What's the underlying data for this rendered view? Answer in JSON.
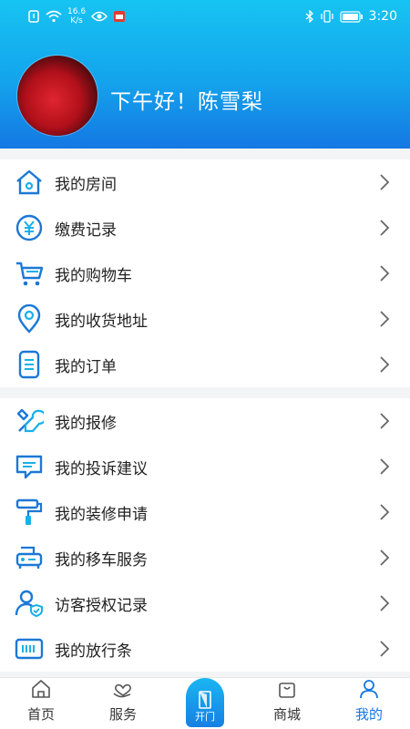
{
  "status": {
    "speed": "16.6",
    "speed_unit": "K/s",
    "time": "3:20"
  },
  "profile": {
    "greeting": "下午好！陈雪梨"
  },
  "menu_group1": [
    {
      "label": "我的房间",
      "icon": "house-icon"
    },
    {
      "label": "缴费记录",
      "icon": "yen-coin-icon"
    },
    {
      "label": "我的购物车",
      "icon": "cart-icon"
    },
    {
      "label": "我的收货地址",
      "icon": "location-pin-icon"
    },
    {
      "label": "我的订单",
      "icon": "order-doc-icon"
    }
  ],
  "menu_group2": [
    {
      "label": "我的报修",
      "icon": "repair-tools-icon"
    },
    {
      "label": "我的投诉建议",
      "icon": "complaint-message-icon"
    },
    {
      "label": "我的装修申请",
      "icon": "paint-roller-icon"
    },
    {
      "label": "我的移车服务",
      "icon": "car-move-icon"
    },
    {
      "label": "访客授权记录",
      "icon": "visitor-shield-icon"
    },
    {
      "label": "我的放行条",
      "icon": "pass-ticket-icon"
    }
  ],
  "tabbar": {
    "home": "首页",
    "service": "服务",
    "open_door": "开门",
    "mall": "商城",
    "mine": "我的"
  },
  "colors": {
    "accent": "#1477e0",
    "header_top": "#16c4f2",
    "header_bottom": "#1478e3"
  }
}
